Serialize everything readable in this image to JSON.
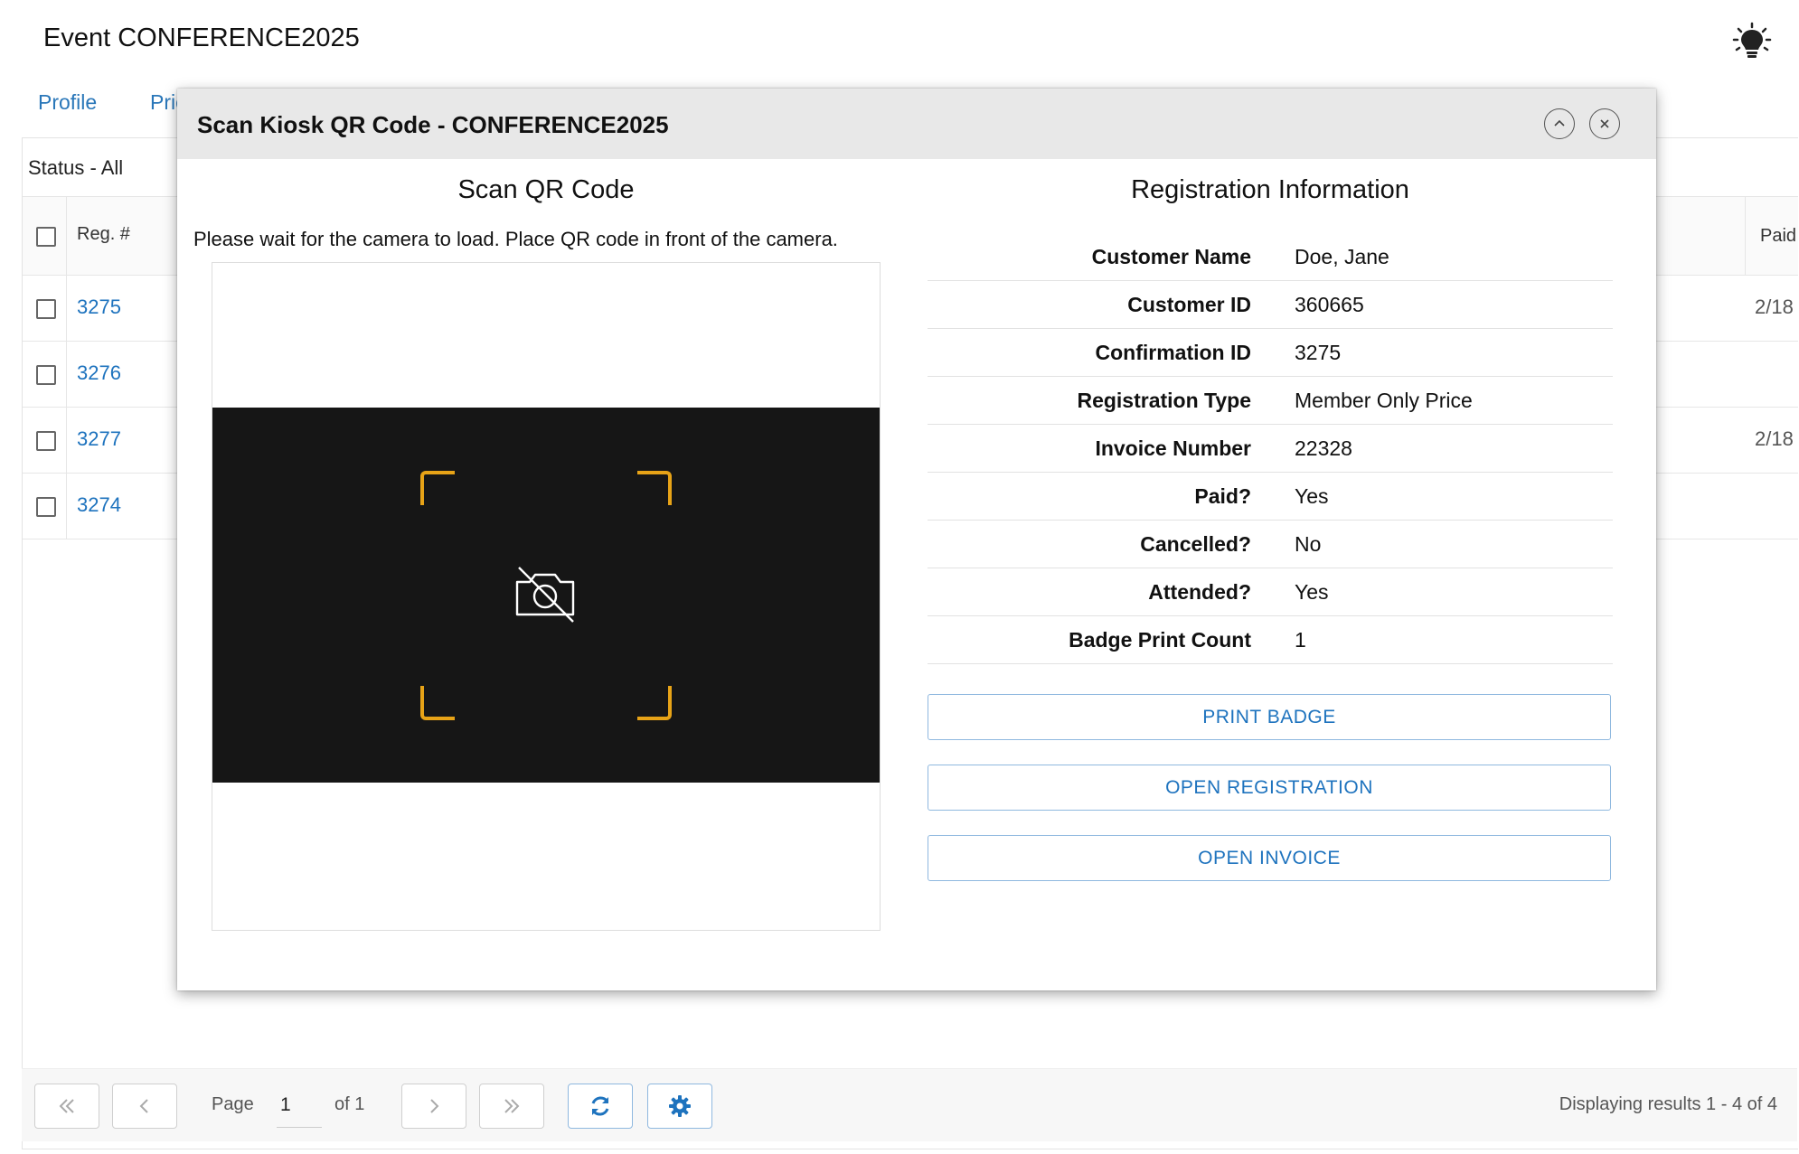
{
  "page": {
    "title": "Event CONFERENCE2025"
  },
  "tabs": [
    "Profile",
    "Pric"
  ],
  "grid": {
    "status_filter": "Status - All",
    "columns": {
      "reg": "Reg. #",
      "paid": "Paid"
    },
    "rows": [
      {
        "reg": "3275",
        "paid": "2/18"
      },
      {
        "reg": "3276",
        "paid": ""
      },
      {
        "reg": "3277",
        "paid": "2/18"
      },
      {
        "reg": "3274",
        "paid": ""
      }
    ]
  },
  "pager": {
    "page_label": "Page",
    "page_value": "1",
    "of_label": "of 1",
    "results": "Displaying results 1 - 4 of 4"
  },
  "modal": {
    "title": "Scan Kiosk QR Code - CONFERENCE2025",
    "scan_title": "Scan QR Code",
    "instruction": "Please wait for the camera to load. Place QR code in front of the camera.",
    "info_title": "Registration Information",
    "fields": [
      {
        "label": "Customer Name",
        "value": "Doe, Jane"
      },
      {
        "label": "Customer ID",
        "value": "360665"
      },
      {
        "label": "Confirmation ID",
        "value": "3275"
      },
      {
        "label": "Registration Type",
        "value": "Member Only Price"
      },
      {
        "label": "Invoice Number",
        "value": "22328"
      },
      {
        "label": "Paid?",
        "value": "Yes"
      },
      {
        "label": "Cancelled?",
        "value": "No"
      },
      {
        "label": "Attended?",
        "value": "Yes"
      },
      {
        "label": "Badge Print Count",
        "value": "1"
      }
    ],
    "buttons": {
      "print_badge": "PRINT BADGE",
      "open_registration": "OPEN REGISTRATION",
      "open_invoice": "OPEN INVOICE"
    }
  },
  "colors": {
    "accent": "#1e73be",
    "scan_corner": "#e7a317",
    "camera_bg": "#161616",
    "header_bg": "#e8e8e8"
  }
}
